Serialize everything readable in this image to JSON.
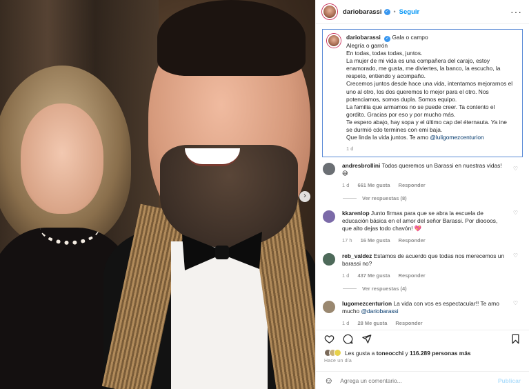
{
  "post": {
    "username": "dariobarassi",
    "follow_label": "Seguir",
    "location": "Gala o campo",
    "caption_lines": [
      "Alegría o garrón",
      "En todas, todas todas, juntos.",
      "La mujer de mi vida es una compañera del carajo, estoy",
      "enamorado, me gusta, me diviertes, la banco, la escucho, la",
      "respeto, entiendo y acompaño.",
      "Crecemos juntos desde hace una vida, intentamos mejorarnos el",
      "uno al otro, los dos queremos lo mejor para el otro. Nos",
      "potenciamos, somos dupla. Somos equipo.",
      "La familia que armamos no se puede creer. Ta contento el",
      "gordito. Gracias por eso y por mucho más.",
      "Te espero abajo, hay sopa y el último cap del éternauta. Ya ine",
      "se durmió cdo termines con emi baja."
    ],
    "caption_last": "Que linda la vida juntos. Te amo",
    "caption_mention": "@luligomezcenturion",
    "caption_time": "1 d",
    "likes_prefix": "Les gusta a",
    "likes_user": "toneocchi",
    "likes_middle": "y",
    "likes_count": "116.289 personas más",
    "posted_ago": "Hace un día",
    "comment_placeholder": "Agrega un comentario...",
    "publish_label": "Publicar"
  },
  "comments": [
    {
      "user": "andresbrollini",
      "text": "Todos queremos un Barassi en nuestras vidas! 😅",
      "time": "1 d",
      "likes": "661 Me gusta",
      "reply": "Responder",
      "replies": "Ver respuestas (8)",
      "avatar_color": "#6b6f74"
    },
    {
      "user": "kkarenlop",
      "text": "Junto firmas para que se abra la escuela de educación básica en el amor del señor Barassi. Por dioooos, que alto dejas todo chavón! 💖",
      "time": "17 h",
      "likes": "16 Me gusta",
      "reply": "Responder",
      "replies": "",
      "avatar_color": "#7b6aa8"
    },
    {
      "user": "reb_valdez",
      "text": "Estamos de acuerdo que todas nos merecemos un barassi no?",
      "time": "1 d",
      "likes": "437 Me gusta",
      "reply": "Responder",
      "replies": "Ver respuestas (4)",
      "avatar_color": "#4e6a5a"
    },
    {
      "user": "lugomezcenturion",
      "text": "La vida con vos es espectacular!! Te amo mucho",
      "mention": "@dariobarassi",
      "time": "1 d",
      "likes": "28 Me gusta",
      "reply": "Responder",
      "replies": "",
      "avatar_color": "#9a8870"
    }
  ],
  "colors": {
    "link_blue": "#0095f6",
    "verified_blue": "#3897f0",
    "muted": "#8e8e8e",
    "caption_border": "#5a8ad6"
  }
}
